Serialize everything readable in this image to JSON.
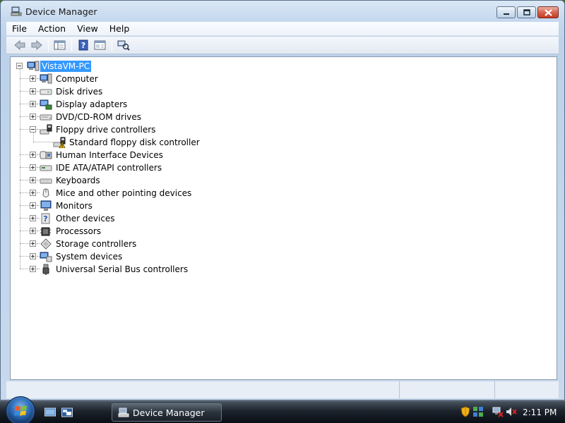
{
  "window": {
    "title": "Device Manager",
    "icon": "device-manager-icon"
  },
  "menu": [
    "File",
    "Action",
    "View",
    "Help"
  ],
  "toolbar": {
    "buttons": [
      "back-arrow-icon",
      "forward-arrow-icon",
      "properties-console-icon",
      "help-icon",
      "properties-icon",
      "scan-hardware-icon"
    ]
  },
  "tree": {
    "root": {
      "label": "VistaVM-PC",
      "icon": "computer-icon",
      "expanded": true,
      "selected": true
    },
    "categories": [
      {
        "label": "Computer",
        "icon": "computer-icon",
        "expanded": false
      },
      {
        "label": "Disk drives",
        "icon": "disk-drive-icon",
        "expanded": false
      },
      {
        "label": "Display adapters",
        "icon": "display-adapter-icon",
        "expanded": false
      },
      {
        "label": "DVD/CD-ROM drives",
        "icon": "dvd-drive-icon",
        "expanded": false
      },
      {
        "label": "Floppy drive controllers",
        "icon": "floppy-controller-icon",
        "expanded": true,
        "children": [
          {
            "label": "Standard floppy disk controller",
            "icon": "floppy-controller-warning-icon",
            "warning": true
          }
        ]
      },
      {
        "label": "Human Interface Devices",
        "icon": "hid-icon",
        "expanded": false
      },
      {
        "label": "IDE ATA/ATAPI controllers",
        "icon": "ide-controller-icon",
        "expanded": false
      },
      {
        "label": "Keyboards",
        "icon": "keyboard-icon",
        "expanded": false
      },
      {
        "label": "Mice and other pointing devices",
        "icon": "mouse-icon",
        "expanded": false
      },
      {
        "label": "Monitors",
        "icon": "monitor-icon",
        "expanded": false
      },
      {
        "label": "Other devices",
        "icon": "other-devices-icon",
        "expanded": false
      },
      {
        "label": "Processors",
        "icon": "processor-icon",
        "expanded": false
      },
      {
        "label": "Storage controllers",
        "icon": "storage-controller-icon",
        "expanded": false
      },
      {
        "label": "System devices",
        "icon": "system-devices-icon",
        "expanded": false
      },
      {
        "label": "Universal Serial Bus controllers",
        "icon": "usb-icon",
        "expanded": false
      }
    ]
  },
  "taskbar": {
    "start": "start-orb-icon",
    "quick_launch": [
      "show-desktop-icon",
      "switch-windows-icon"
    ],
    "task_button_label": "Device Manager",
    "tray": [
      "security-shield-icon",
      "network-icon",
      "network-disconnected-icon",
      "volume-muted-icon"
    ],
    "clock": "2:11 PM"
  },
  "colors": {
    "selection": "#3399ff",
    "warning": "#f2c200"
  }
}
